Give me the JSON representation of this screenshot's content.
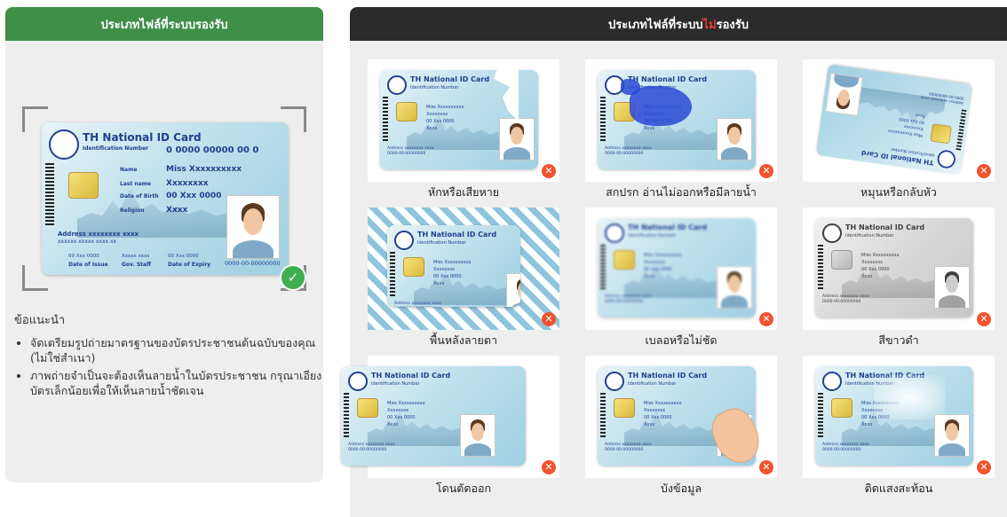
{
  "left": {
    "header": "ประเภทไฟล์ที่ระบบรองรับ",
    "card": {
      "title": "TH National ID Card",
      "id_label": "Identification Number",
      "id_number": "0 0000 00000 00 0",
      "rows": [
        {
          "label": "Name",
          "value": "Miss Xxxxxxxxxx"
        },
        {
          "label": "Last name",
          "value": "Xxxxxxxx"
        },
        {
          "label": "Date of Birth",
          "value": "00 Xxx 0000"
        },
        {
          "label": "Religion",
          "value": "Xxxx"
        }
      ],
      "address": "Address xxxxxxxx xxxx",
      "address2": "xxxxxx xxxxx xxxx xx",
      "footer_values": [
        "00 Xxx 0000",
        "Xxxxx xxxx",
        "00 Xxx 0000"
      ],
      "footer_labels": [
        "Date of Issue",
        "Gov. Staff",
        "Date of Expiry"
      ],
      "serial": "0000-00-00000000"
    },
    "advice_title": "ข้อแนะนำ",
    "advice_items": [
      "จัดเตรียมรูปถ่ายมาตรฐานของบัตรประชาชนต้นฉบับของคุณ (ไม่ใช่สำเนา)",
      "ภาพถ่ายจำเป็นจะต้องเห็นลายน้ำในบัตรประชาชน กรุณาเอียงบัตรเล็กน้อยเพื่อให้เห็นลายน้ำชัดเจน"
    ],
    "colors": {
      "header": "#3f8f47",
      "ok": "#3fae4e"
    }
  },
  "right": {
    "header_prefix": "ประเภทไฟล์ที่ระบบ",
    "header_highlight": "ไม่",
    "header_suffix": "รองรับ",
    "colors": {
      "header": "#2b2b2b",
      "highlight": "#e53935",
      "reject": "#f2522e"
    },
    "tiles": [
      {
        "label": "หักหรือเสียหาย"
      },
      {
        "label": "สกปรก อ่านไม่ออกหรือมีลายน้ำ"
      },
      {
        "label": "หมุนหรือกลับหัว"
      },
      {
        "label": "พื้นหลังลายตา"
      },
      {
        "label": "เบลอหรือไม่ชัด"
      },
      {
        "label": "สีขาวดำ"
      },
      {
        "label": "โดนตัดออก"
      },
      {
        "label": "บังข้อมูล"
      },
      {
        "label": "ติดแสงสะท้อน"
      }
    ]
  }
}
